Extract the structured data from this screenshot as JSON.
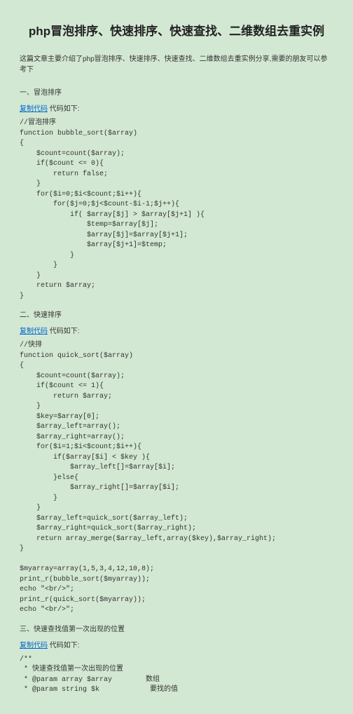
{
  "title": "php冒泡排序、快速排序、快速查找、二维数组去重实例",
  "intro": "这篇文章主要介绍了php冒泡排序、快速排序、快速查找、二维数组去重实例分享,需要的朋友可以参考下",
  "section1": {
    "heading": "一、冒泡排序",
    "copy_link": "复制代码",
    "copy_suffix": " 代码如下:",
    "code": "//冒泡排序\nfunction bubble_sort($array)\n{\n    $count=count($array);\n    if($count <= 0){\n        return false;\n    }\n    for($i=0;$i<$count;$i++){\n        for($j=0;$j<$count-$i-1;$j++){\n            if( $array[$j] > $array[$j+1] ){\n                $temp=$array[$j];\n                $array[$j]=$array[$j+1];\n                $array[$j+1]=$temp;\n            }\n        }\n    }\n    return $array;\n}"
  },
  "section2": {
    "heading": "二、快速排序",
    "copy_link": "复制代码",
    "copy_suffix": " 代码如下:",
    "code": "//快排\nfunction quick_sort($array)\n{\n    $count=count($array);\n    if($count <= 1){\n        return $array;\n    }\n    $key=$array[0];\n    $array_left=array();\n    $array_right=array();\n    for($i=1;$i<$count;$i++){\n        if($array[$i] < $key ){\n            $array_left[]=$array[$i];\n        }else{\n            $array_right[]=$array[$i];\n        }\n    }\n    $array_left=quick_sort($array_left);\n    $array_right=quick_sort($array_right);\n    return array_merge($array_left,array($key),$array_right);\n}\n\n$myarray=array(1,5,3,4,12,10,8);\nprint_r(bubble_sort($myarray));\necho \"<br/>\";\nprint_r(quick_sort($myarray));\necho \"<br/>\";"
  },
  "section3": {
    "heading": "三、快速查找值第一次出现的位置",
    "copy_link": "复制代码",
    "copy_suffix": " 代码如下:",
    "code": "/**\n * 快速查找值第一次出现的位置\n * @param array $array        数组\n * @param string $k            要找的值"
  }
}
